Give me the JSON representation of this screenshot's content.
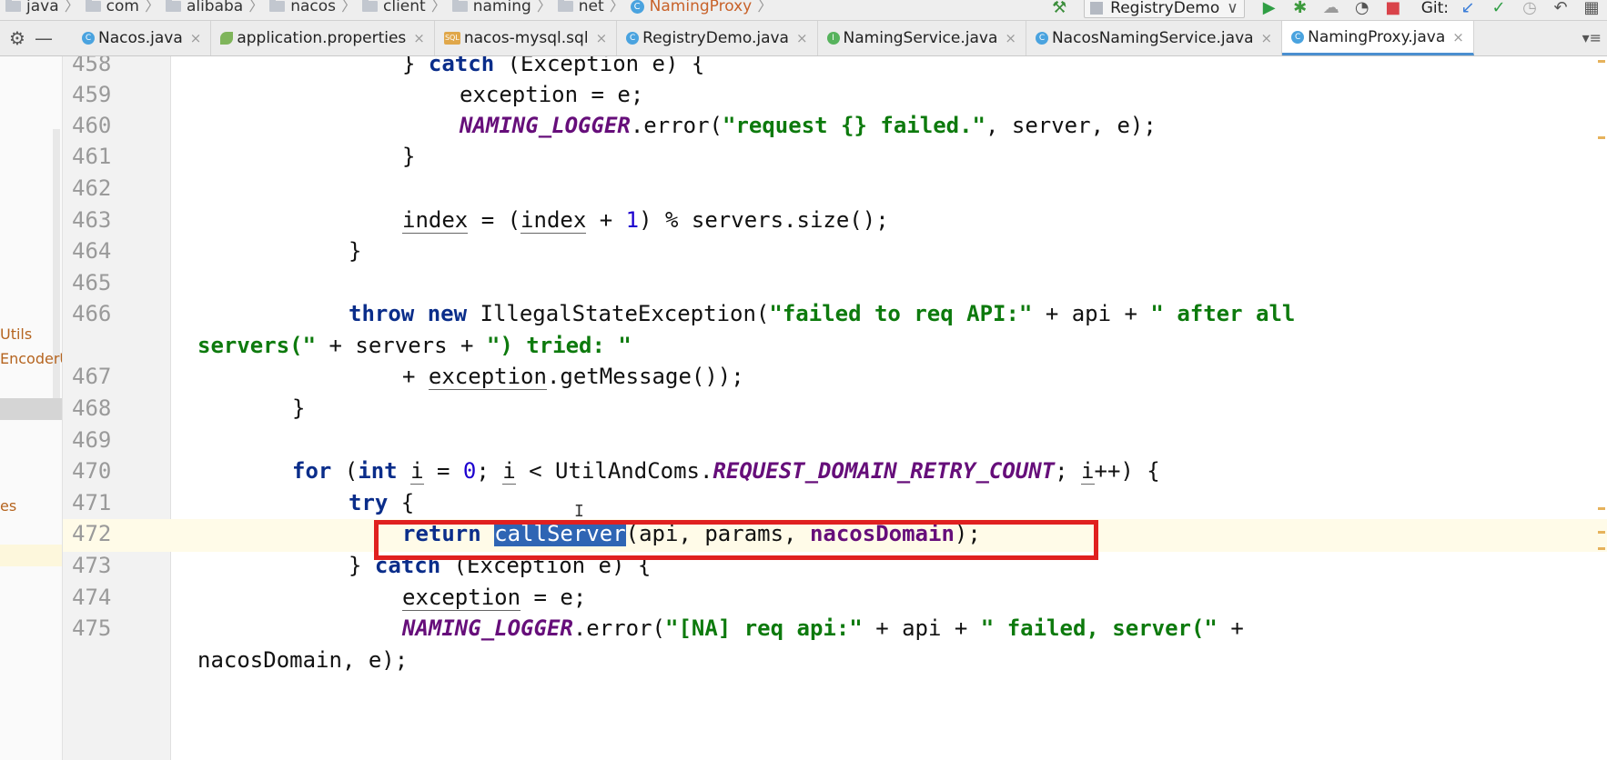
{
  "breadcrumb": [
    {
      "label": "java",
      "icon": "folder-icon"
    },
    {
      "label": "com",
      "icon": "folder-icon"
    },
    {
      "label": "alibaba",
      "icon": "folder-icon"
    },
    {
      "label": "nacos",
      "icon": "folder-icon"
    },
    {
      "label": "client",
      "icon": "folder-icon"
    },
    {
      "label": "naming",
      "icon": "folder-icon"
    },
    {
      "label": "net",
      "icon": "folder-icon"
    },
    {
      "label": "NamingProxy",
      "icon": "class-icon"
    }
  ],
  "toolbar": {
    "run_config": "RegistryDemo",
    "git_label": "Git:"
  },
  "tabs": [
    {
      "label": "Nacos.java",
      "icon": "c"
    },
    {
      "label": "application.properties",
      "icon": "leaf"
    },
    {
      "label": "nacos-mysql.sql",
      "icon": "sql"
    },
    {
      "label": "RegistryDemo.java",
      "icon": "c"
    },
    {
      "label": "NamingService.java",
      "icon": "i"
    },
    {
      "label": "NacosNamingService.java",
      "icon": "c"
    },
    {
      "label": "NamingProxy.java",
      "icon": "c",
      "active": true
    }
  ],
  "project_panel": {
    "items": [
      "Utils",
      "EncoderU",
      "es"
    ]
  },
  "editor": {
    "line_numbers": [
      "458",
      "459",
      "460",
      "461",
      "462",
      "463",
      "464",
      "465",
      "466",
      "",
      "467",
      "468",
      "469",
      "470",
      "471",
      "472",
      "473",
      "474",
      "475",
      ""
    ],
    "strings": {
      "s1": "\"request {} failed.\"",
      "s2a": "\"failed to req API:\"",
      "s2b": "\" after all",
      "s2c": "servers(\"",
      "s2d": "\") tried: \"",
      "s3": "\"[NA] req api:\"",
      "s4": "\" failed, server(\""
    },
    "constants": {
      "logger": "NAMING_LOGGER",
      "retry": "REQUEST_DOMAIN_RETRY_COUNT"
    },
    "highlighted_symbol": "callServer"
  }
}
